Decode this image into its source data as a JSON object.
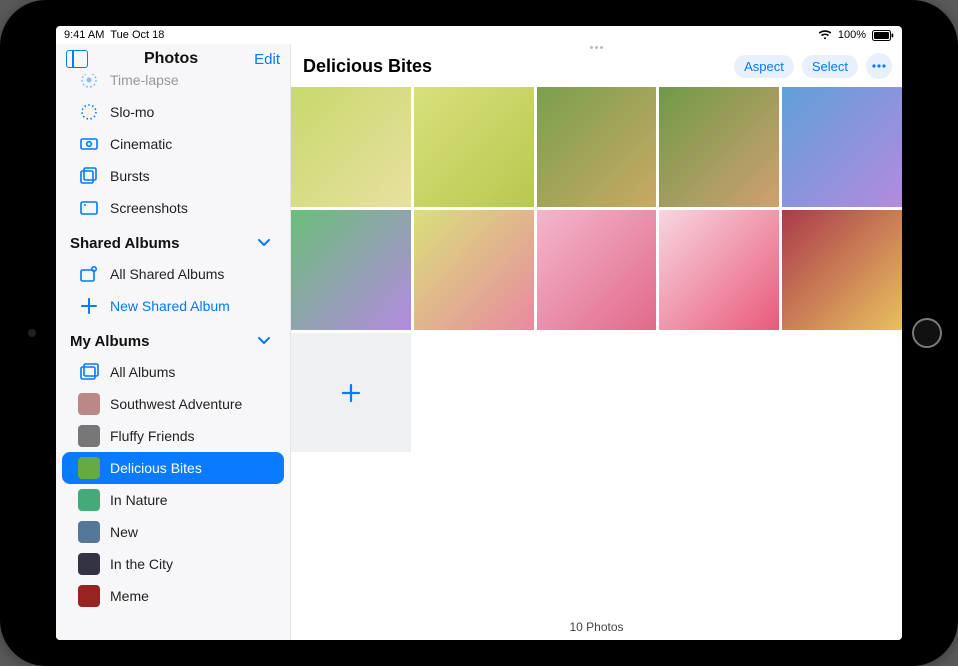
{
  "statusbar": {
    "time": "9:41 AM",
    "date": "Tue Oct 18",
    "battery_pct": "100%"
  },
  "sidebar": {
    "title": "Photos",
    "edit": "Edit",
    "media_types": [
      {
        "label": "Time-lapse",
        "icon": "timelapse"
      },
      {
        "label": "Slo-mo",
        "icon": "slomo"
      },
      {
        "label": "Cinematic",
        "icon": "cinematic"
      },
      {
        "label": "Bursts",
        "icon": "bursts"
      },
      {
        "label": "Screenshots",
        "icon": "screenshots"
      }
    ],
    "shared_header": "Shared Albums",
    "shared_items": [
      {
        "label": "All Shared Albums",
        "icon": "shared"
      },
      {
        "label": "New Shared Album",
        "icon": "plus",
        "blue": true
      }
    ],
    "my_header": "My Albums",
    "my_items": [
      {
        "label": "All Albums",
        "icon": "albums"
      },
      {
        "label": "Southwest Adventure",
        "thumb": "#b88"
      },
      {
        "label": "Fluffy Friends",
        "thumb": "#777"
      },
      {
        "label": "Delicious Bites",
        "thumb": "#6a4",
        "selected": true
      },
      {
        "label": "In Nature",
        "thumb": "#4a7"
      },
      {
        "label": "New",
        "thumb": "#579"
      },
      {
        "label": "In the City",
        "thumb": "#334"
      },
      {
        "label": "Meme",
        "thumb": "#922"
      }
    ]
  },
  "main": {
    "title": "Delicious Bites",
    "action_aspect": "Aspect",
    "action_select": "Select",
    "photo_count": "10 Photos",
    "photos": [
      "p1",
      "p2",
      "p3",
      "p4",
      "p5",
      "p6",
      "p7",
      "p8",
      "p9",
      "p10"
    ]
  }
}
